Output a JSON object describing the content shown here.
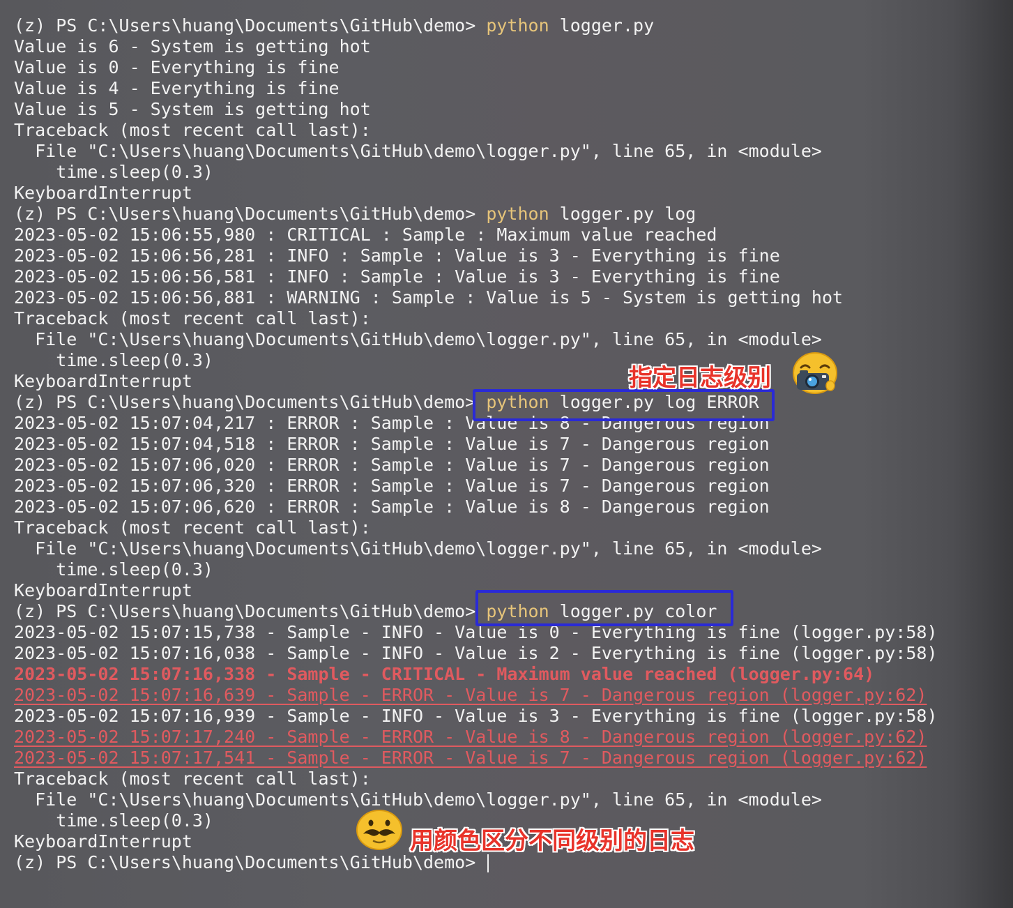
{
  "terminal": {
    "lines": [
      {
        "pre": "(z) PS C:\\Users\\huang\\Documents\\GitHub\\demo> ",
        "cmd": "python",
        "post": " logger.py",
        "style": "normal"
      },
      {
        "text": "Value is 6 - System is getting hot",
        "style": "normal"
      },
      {
        "text": "Value is 0 - Everything is fine",
        "style": "normal"
      },
      {
        "text": "Value is 4 - Everything is fine",
        "style": "normal"
      },
      {
        "text": "Value is 5 - System is getting hot",
        "style": "normal"
      },
      {
        "text": "Traceback (most recent call last):",
        "style": "normal"
      },
      {
        "text": "  File \"C:\\Users\\huang\\Documents\\GitHub\\demo\\logger.py\", line 65, in <module>",
        "style": "normal"
      },
      {
        "text": "    time.sleep(0.3)",
        "style": "normal"
      },
      {
        "text": "KeyboardInterrupt",
        "style": "normal"
      },
      {
        "pre": "(z) PS C:\\Users\\huang\\Documents\\GitHub\\demo> ",
        "cmd": "python",
        "post": " logger.py log",
        "style": "normal"
      },
      {
        "text": "2023-05-02 15:06:55,980 : CRITICAL : Sample : Maximum value reached",
        "style": "normal"
      },
      {
        "text": "2023-05-02 15:06:56,281 : INFO : Sample : Value is 3 - Everything is fine",
        "style": "normal"
      },
      {
        "text": "2023-05-02 15:06:56,581 : INFO : Sample : Value is 3 - Everything is fine",
        "style": "normal"
      },
      {
        "text": "2023-05-02 15:06:56,881 : WARNING : Sample : Value is 5 - System is getting hot",
        "style": "normal"
      },
      {
        "text": "Traceback (most recent call last):",
        "style": "normal"
      },
      {
        "text": "  File \"C:\\Users\\huang\\Documents\\GitHub\\demo\\logger.py\", line 65, in <module>",
        "style": "normal"
      },
      {
        "text": "    time.sleep(0.3)",
        "style": "normal"
      },
      {
        "text": "KeyboardInterrupt",
        "style": "normal"
      },
      {
        "pre": "(z) PS C:\\Users\\huang\\Documents\\GitHub\\demo> ",
        "cmd": "python",
        "post": " logger.py log ERROR",
        "style": "normal"
      },
      {
        "text": "2023-05-02 15:07:04,217 : ERROR : Sample : Value is 8 - Dangerous region",
        "style": "normal"
      },
      {
        "text": "2023-05-02 15:07:04,518 : ERROR : Sample : Value is 7 - Dangerous region",
        "style": "normal"
      },
      {
        "text": "2023-05-02 15:07:06,020 : ERROR : Sample : Value is 7 - Dangerous region",
        "style": "normal"
      },
      {
        "text": "2023-05-02 15:07:06,320 : ERROR : Sample : Value is 7 - Dangerous region",
        "style": "normal"
      },
      {
        "text": "2023-05-02 15:07:06,620 : ERROR : Sample : Value is 8 - Dangerous region",
        "style": "normal"
      },
      {
        "text": "Traceback (most recent call last):",
        "style": "normal"
      },
      {
        "text": "  File \"C:\\Users\\huang\\Documents\\GitHub\\demo\\logger.py\", line 65, in <module>",
        "style": "normal"
      },
      {
        "text": "    time.sleep(0.3)",
        "style": "normal"
      },
      {
        "text": "KeyboardInterrupt",
        "style": "normal"
      },
      {
        "pre": "(z) PS C:\\Users\\huang\\Documents\\GitHub\\demo> ",
        "cmd": "python",
        "post": " logger.py color",
        "style": "normal"
      },
      {
        "text": "2023-05-02 15:07:15,738 - Sample - INFO - Value is 0 - Everything is fine (logger.py:58)",
        "style": "normal"
      },
      {
        "text": "2023-05-02 15:07:16,038 - Sample - INFO - Value is 2 - Everything is fine (logger.py:58)",
        "style": "normal"
      },
      {
        "text": "2023-05-02 15:07:16,338 - Sample - CRITICAL - Maximum value reached (logger.py:64)",
        "style": "crit"
      },
      {
        "text": "2023-05-02 15:07:16,639 - Sample - ERROR - Value is 7 - Dangerous region (logger.py:62)",
        "style": "err"
      },
      {
        "text": "2023-05-02 15:07:16,939 - Sample - INFO - Value is 3 - Everything is fine (logger.py:58)",
        "style": "normal"
      },
      {
        "text": "2023-05-02 15:07:17,240 - Sample - ERROR - Value is 8 - Dangerous region (logger.py:62)",
        "style": "err"
      },
      {
        "text": "2023-05-02 15:07:17,541 - Sample - ERROR - Value is 7 - Dangerous region (logger.py:62)",
        "style": "err"
      },
      {
        "text": "Traceback (most recent call last):",
        "style": "normal"
      },
      {
        "text": "  File \"C:\\Users\\huang\\Documents\\GitHub\\demo\\logger.py\", line 65, in <module>",
        "style": "normal"
      },
      {
        "text": "    time.sleep(0.3)",
        "style": "normal"
      },
      {
        "text": "KeyboardInterrupt",
        "style": "normal"
      },
      {
        "pre": "(z) PS C:\\Users\\huang\\Documents\\GitHub\\demo> ",
        "cmd": "",
        "post": "",
        "style": "prompt-cursor"
      }
    ]
  },
  "annotations": {
    "log_level": "指定日志级别",
    "color_levels": "用颜色区分不同级别的日志"
  },
  "colors": {
    "text": "#f2f2f2",
    "command_keyword": "#e6c47a",
    "error_red": "#e05a5f",
    "highlight_box": "#2a2ad6",
    "annotation_red": "#e8332a"
  },
  "icons": {
    "camera_emoji": "face-with-camera-icon",
    "mustache_emoji": "mustache-face-icon"
  }
}
